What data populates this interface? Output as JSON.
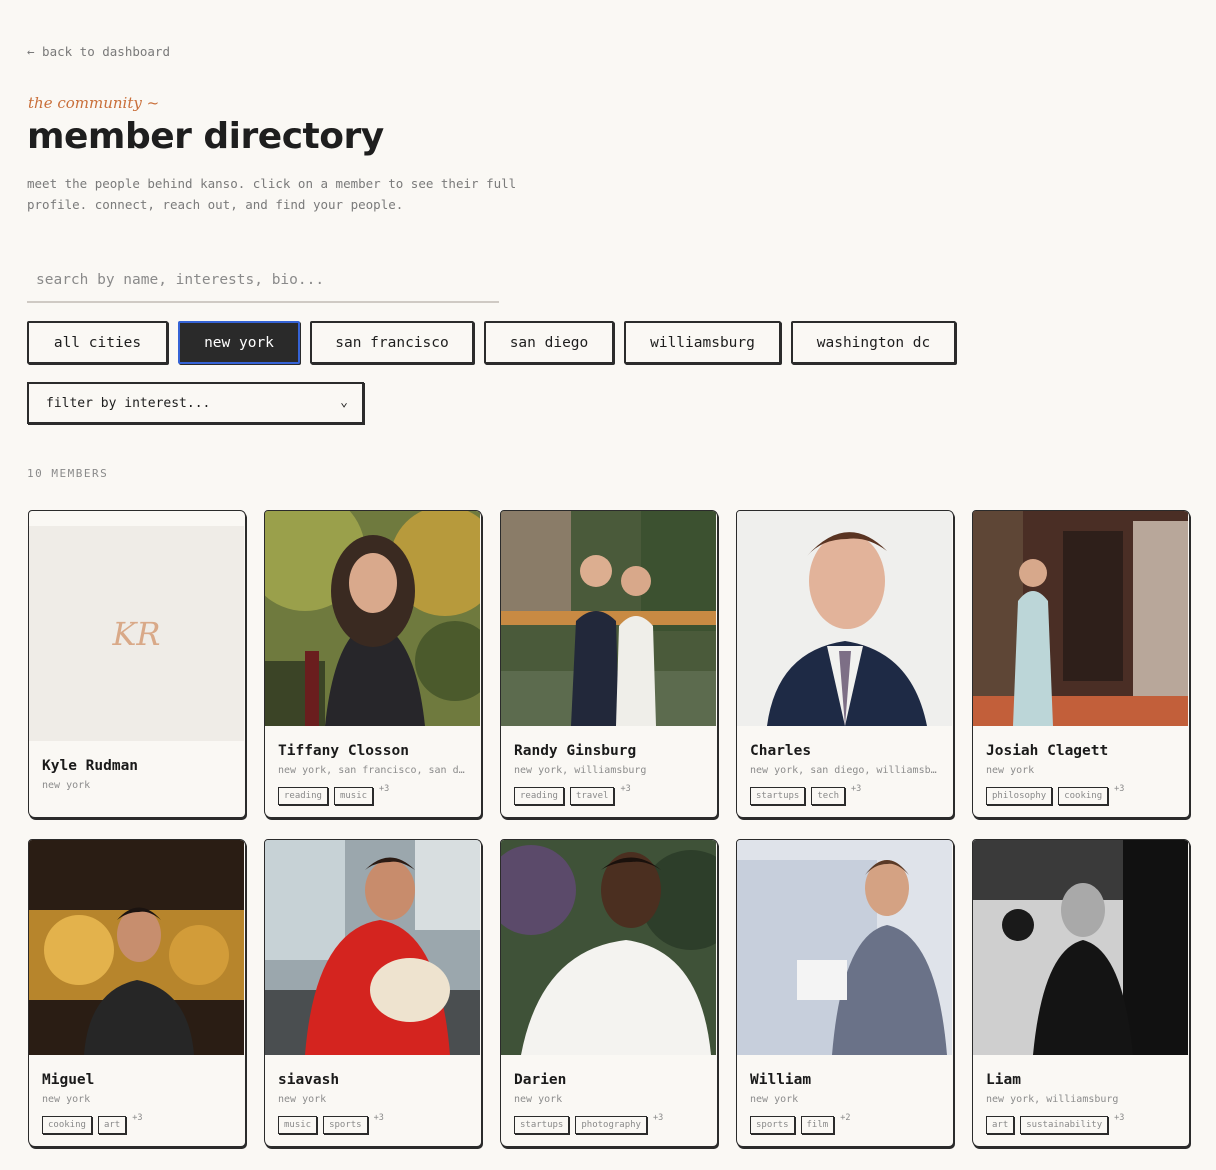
{
  "nav": {
    "back_label": "← back to dashboard"
  },
  "header": {
    "eyebrow": "the community ~",
    "title": "member directory",
    "intro": "meet the people behind kanso. click on a member to see their full profile. connect, reach out, and find your people."
  },
  "search": {
    "placeholder": "search by name, interests, bio..."
  },
  "city_filters": [
    {
      "label": "all cities",
      "active": false
    },
    {
      "label": "new york",
      "active": true
    },
    {
      "label": "san francisco",
      "active": false
    },
    {
      "label": "san diego",
      "active": false
    },
    {
      "label": "williamsburg",
      "active": false
    },
    {
      "label": "washington dc",
      "active": false
    }
  ],
  "interest_filter": {
    "selected": "filter by interest...",
    "chevron_icon": "chevron-down-icon"
  },
  "results": {
    "count_label": "10 MEMBERS"
  },
  "members": [
    {
      "name": "Kyle Rudman",
      "cities": "new york",
      "initials": "KR",
      "tags": [],
      "more": ""
    },
    {
      "name": "Tiffany Closson",
      "cities": "new york, san francisco, san diego",
      "tags": [
        "reading",
        "music"
      ],
      "more": "+3"
    },
    {
      "name": "Randy Ginsburg",
      "cities": "new york, williamsburg",
      "tags": [
        "reading",
        "travel"
      ],
      "more": "+3"
    },
    {
      "name": "Charles",
      "cities": "new york, san diego, williamsburg",
      "tags": [
        "startups",
        "tech"
      ],
      "more": "+3"
    },
    {
      "name": "Josiah Clagett",
      "cities": "new york",
      "tags": [
        "philosophy",
        "cooking"
      ],
      "more": "+3"
    },
    {
      "name": "Miguel",
      "cities": "new york",
      "tags": [
        "cooking",
        "art"
      ],
      "more": "+3"
    },
    {
      "name": "siavash",
      "cities": "new york",
      "tags": [
        "music",
        "sports"
      ],
      "more": "+3"
    },
    {
      "name": "Darien",
      "cities": "new york",
      "tags": [
        "startups",
        "photography"
      ],
      "more": "+3"
    },
    {
      "name": "William",
      "cities": "new york",
      "tags": [
        "sports",
        "film"
      ],
      "more": "+2"
    },
    {
      "name": "Liam",
      "cities": "new york, williamsburg",
      "tags": [
        "art",
        "sustainability"
      ],
      "more": "+3"
    }
  ],
  "colors": {
    "accent": "#c96f3a",
    "active_pill_bg": "#2a2a2a",
    "active_pill_border": "#3563d6",
    "background": "#faf8f4"
  }
}
